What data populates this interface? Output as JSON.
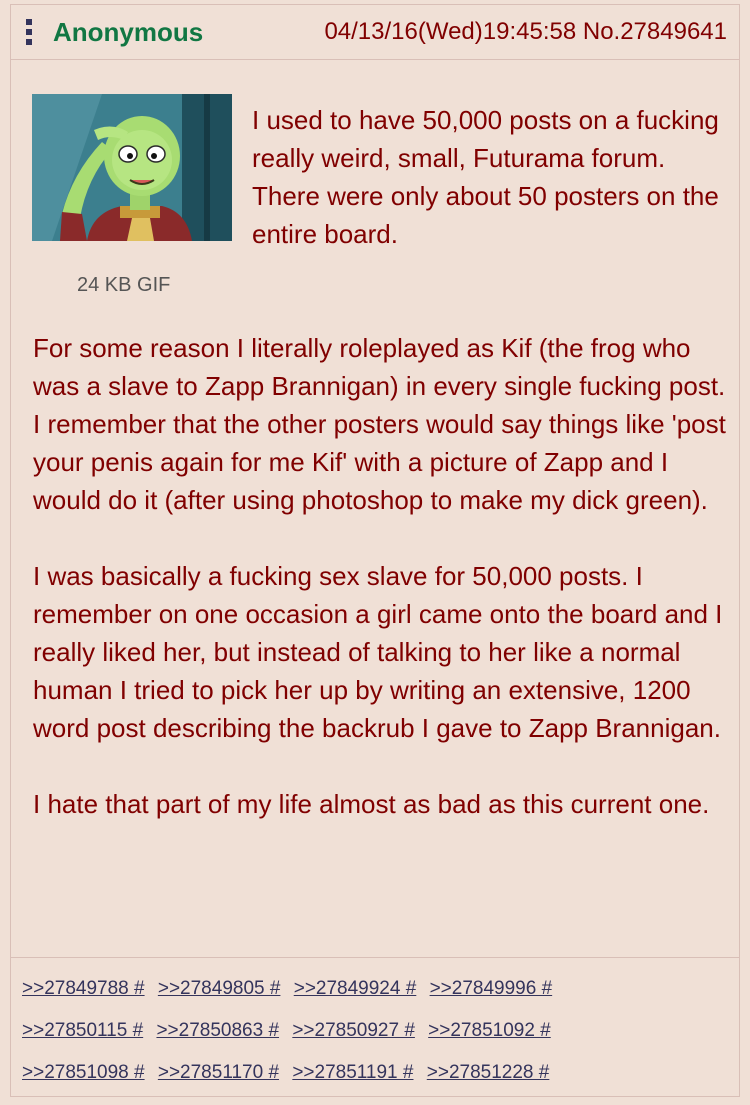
{
  "post": {
    "name": "Anonymous",
    "datetime": "04/13/16(Wed)19:45:58",
    "post_number": "No.27849641",
    "file_info": "24 KB GIF",
    "menu_icon": "vertical-ellipsis-icon",
    "thumbnail_icon": "kif-salute-image"
  },
  "text_top": "I used to have 50,000 posts on a fucking really weird, small, Futurama forum. There were only about 50 posters on the entire board.",
  "paragraphs": [
    "For some reason I literally roleplayed as Kif (the frog who was a slave to Zapp Brannigan) in every single fucking post. I remember that the other posters would say things like 'post your penis again for me Kif' with a picture of Zapp and I would do it (after using photoshop to make my dick green).",
    "I was basically a fucking sex slave for 50,000 posts. I remember on one occasion a girl came onto the board and I really liked her, but instead of talking to her like a normal human I tried to pick her up by writing an extensive, 1200 word post describing the backrub I gave to Zapp Brannigan.",
    "I hate that part of my life almost as bad as this current one."
  ],
  "replies": [
    [
      ">>27849788 #",
      ">>27849805 #",
      ">>27849924 #",
      ">>27849996 #"
    ],
    [
      ">>27850115 #",
      ">>27850863 #",
      ">>27850927 #",
      ">>27851092 #"
    ],
    [
      ">>27851098 #",
      ">>27851170 #",
      ">>27851191 #",
      ">>27851228 #"
    ]
  ],
  "colors": {
    "background": "#f0e0d6",
    "name": "#117743",
    "text": "#800000",
    "link": "#34345c"
  }
}
